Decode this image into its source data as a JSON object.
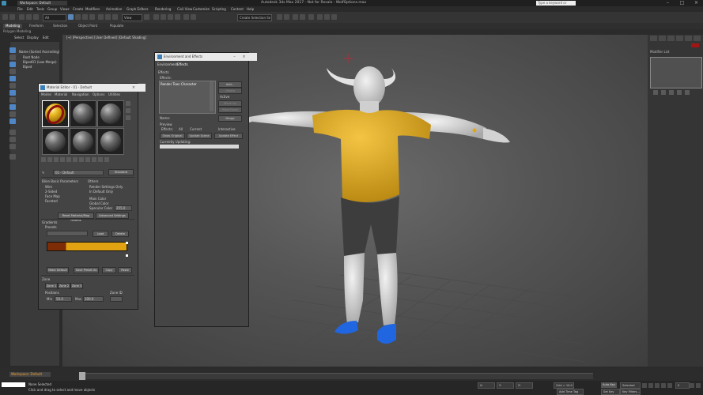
{
  "window": {
    "workspace": "Workspace: Default",
    "title": "Autodesk 3ds Max 2017 - Not for Resale - WolfOptions.max",
    "search_placeholder": "Type a keyword or phrase",
    "controls": [
      "–",
      "□",
      "×"
    ]
  },
  "menubar": [
    "File",
    "Edit",
    "Tools",
    "Group",
    "Views",
    "Create",
    "Modifiers",
    "Animation",
    "Graph Editors",
    "Rendering",
    "Civil View",
    "Customize",
    "Scripting",
    "Content",
    "Help"
  ],
  "toolbar": {
    "selection_filter": "All",
    "view_mode": "View",
    "named_selection": "Create Selection Se"
  },
  "ribbon": {
    "tabs": [
      "Modeling",
      "Freeform",
      "Selection",
      "Object Paint",
      "Populate"
    ],
    "active": "Modeling",
    "sublabel": "Polygon Modeling"
  },
  "scene_explorer": {
    "tabs": [
      "Select",
      "Display",
      "Edit"
    ],
    "rows": [
      "Name (Sorted Ascending)",
      "Root Node",
      "Biped01 (Low Merge)",
      "Biped"
    ]
  },
  "viewport": {
    "label": "[+] [Perspective] [User Defined] [Default Shading]"
  },
  "command_panel": {
    "modifier_list_label": "Modifier List",
    "color": "#a11515"
  },
  "material_editor": {
    "title": "Material Editor - 01 - Default",
    "menu": [
      "Modes",
      "Material",
      "Navigation",
      "Options",
      "Utilities"
    ],
    "type_button": "Standard",
    "sample_label": "01 - Default",
    "sections": {
      "shader": "Blinn Basic Parameters",
      "wire": "Wire",
      "two_sided": "2-Sided",
      "face_map": "Face Map",
      "faceted": "Faceted",
      "others": "Others",
      "render_label": "Render Settings Only",
      "in_default": "In Default Only",
      "u_label": "Main Color",
      "u_value": "Global Color",
      "glossiness_label": "Specular Color",
      "glossiness_value": "255.0",
      "btn_left": "Reset Material/Map Params",
      "btn_right": "Advanced Settings",
      "gradients": "Gradients",
      "presets_label": "Presets",
      "load": "Load",
      "delete": "Delete",
      "make_default": "Make Default",
      "save_preset": "Save Preset As",
      "copy": "Copy",
      "paste": "Paste",
      "zone": "Zone",
      "zone_tabs": [
        "Zone 1",
        "Zone 2",
        "Zone 3"
      ],
      "positions": "Positions",
      "zone_id": "Zone ID",
      "min_label": "Min",
      "min_value": "50.0",
      "max_label": "Max",
      "max_value": "100.0"
    },
    "gradient_colors": [
      "#7e2c06",
      "#e2a312"
    ]
  },
  "env_dialog": {
    "title": "Environment and Effects",
    "tabs": [
      "Environment",
      "Effects"
    ],
    "section": "Effects",
    "list_label": "Effects:",
    "list_item": "Render Toon Character",
    "buttons": [
      "Add...",
      "Delete",
      "Active",
      "Move Up",
      "Move Down",
      "Merge"
    ],
    "name_label": "Name:",
    "preview_label": "Preview",
    "effects_label": "Effects:",
    "all": "All",
    "current": "Current",
    "interactive": "Interactive",
    "show_original": "Show Original",
    "update_scene": "Update Scene",
    "update_effect": "Update Effect",
    "status": "Currently Updating:"
  },
  "status": {
    "workspace": "Workspace: Default",
    "line1": "None Selected",
    "line2": "Click and drag to select and move objects",
    "x": "X:",
    "y": "Y:",
    "z": "Z:",
    "grid": "Grid = 10.0",
    "auto_key": "Auto Key",
    "selected": "Selected",
    "set_key": "Set Key",
    "key_filters": "Key Filters...",
    "add_time_tag": "Add Time Tag",
    "frame": "0"
  },
  "character": {
    "shirt_color": "#e3ad1e",
    "shoe_color": "#1f66e0",
    "shorts_color": "#3a3a3a",
    "skin_color": "#d8d8d8"
  }
}
